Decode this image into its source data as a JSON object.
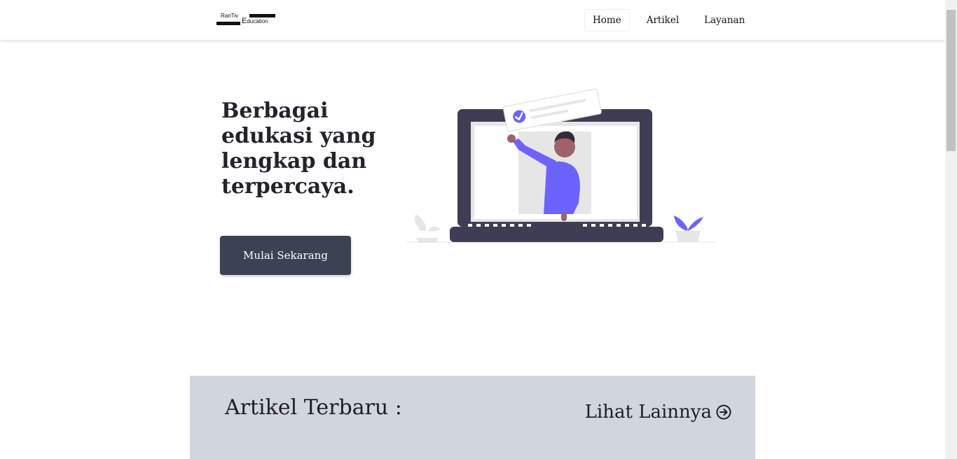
{
  "header": {
    "logo": {
      "line1": "RanTiv",
      "initial": "E",
      "line2": "ducation"
    },
    "nav": [
      {
        "label": "Home",
        "active": true
      },
      {
        "label": "Artikel",
        "active": false
      },
      {
        "label": "Layanan",
        "active": false
      }
    ]
  },
  "hero": {
    "title": "Berbagai edukasi yang lengkap dan terpercaya.",
    "cta_label": "Mulai Sekarang",
    "illustration_icon": "person-on-laptop-illustration"
  },
  "articles": {
    "title": "Artikel Terbaru :",
    "see_more_label": "Lihat Lainnya",
    "see_more_icon": "arrow-circle-right-icon"
  },
  "colors": {
    "accent": "#6c63ff",
    "button": "#3a4254",
    "section_bg": "#d1d5dd",
    "laptop": "#3f3d56"
  }
}
